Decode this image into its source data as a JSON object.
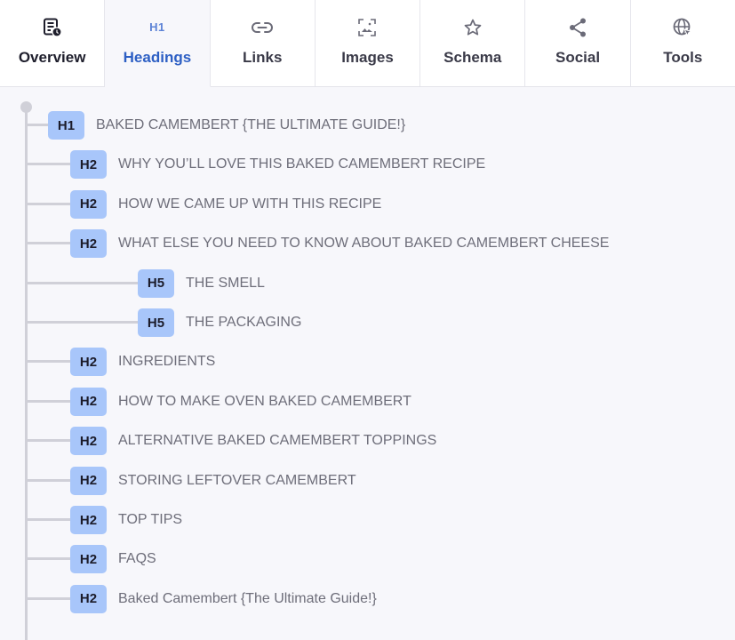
{
  "tabs": [
    {
      "id": "overview",
      "label": "Overview",
      "icon": "overview-report-icon",
      "active": false
    },
    {
      "id": "headings",
      "label": "Headings",
      "icon_text": "H1",
      "active": true
    },
    {
      "id": "links",
      "label": "Links",
      "icon": "link-icon",
      "active": false
    },
    {
      "id": "images",
      "label": "Images",
      "icon": "image-icon",
      "active": false
    },
    {
      "id": "schema",
      "label": "Schema",
      "icon": "star-icon",
      "active": false
    },
    {
      "id": "social",
      "label": "Social",
      "icon": "share-icon",
      "active": false
    },
    {
      "id": "tools",
      "label": "Tools",
      "icon": "globe-cursor-icon",
      "active": false
    }
  ],
  "headings": [
    {
      "level": "H1",
      "text": "BAKED CAMEMBERT {THE ULTIMATE GUIDE!}"
    },
    {
      "level": "H2",
      "text": "WHY YOU’LL LOVE THIS BAKED CAMEMBERT RECIPE"
    },
    {
      "level": "H2",
      "text": "HOW WE CAME UP WITH THIS RECIPE"
    },
    {
      "level": "H2",
      "text": "WHAT ELSE YOU NEED TO KNOW ABOUT BAKED CAMEMBERT CHEESE"
    },
    {
      "level": "H5",
      "text": "THE SMELL"
    },
    {
      "level": "H5",
      "text": "THE PACKAGING"
    },
    {
      "level": "H2",
      "text": "INGREDIENTS"
    },
    {
      "level": "H2",
      "text": "HOW TO MAKE OVEN BAKED CAMEMBERT"
    },
    {
      "level": "H2",
      "text": "ALTERNATIVE BAKED CAMEMBERT TOPPINGS"
    },
    {
      "level": "H2",
      "text": "STORING LEFTOVER CAMEMBERT"
    },
    {
      "level": "H2",
      "text": "TOP TIPS"
    },
    {
      "level": "H2",
      "text": "FAQS"
    },
    {
      "level": "H2",
      "text": "Baked Camembert {The Ultimate Guide!}"
    }
  ],
  "colors": {
    "accent": "#2d5fc4",
    "badge": "#a8c6fa",
    "tree_line": "#d0d0d8"
  }
}
